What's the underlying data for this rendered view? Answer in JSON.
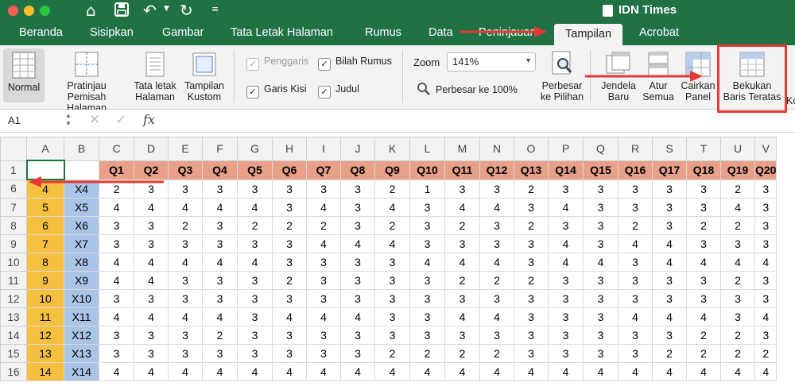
{
  "window": {
    "title": "IDN Times"
  },
  "tabs": [
    {
      "label": "Beranda",
      "active": false
    },
    {
      "label": "Sisipkan",
      "active": false
    },
    {
      "label": "Gambar",
      "active": false
    },
    {
      "label": "Tata Letak Halaman",
      "active": false
    },
    {
      "label": "Rumus",
      "active": false
    },
    {
      "label": "Data",
      "active": false
    },
    {
      "label": "Peninjauan",
      "active": false
    },
    {
      "label": "Tampilan",
      "active": true
    },
    {
      "label": "Acrobat",
      "active": false
    }
  ],
  "ribbon": {
    "normal": "Normal",
    "page_break_1": "Pratinjau",
    "page_break_2": "Pemisah Halaman",
    "page_layout_1": "Tata letak",
    "page_layout_2": "Halaman",
    "custom_view_1": "Tampilan",
    "custom_view_2": "Kustom",
    "ruler": "Penggaris",
    "formula_bar": "Bilah Rumus",
    "gridlines": "Garis Kisi",
    "headings": "Judul",
    "zoom_label": "Zoom",
    "zoom_value": "141%",
    "zoom_100": "Perbesar ke 100%",
    "zoom_sel_1": "Perbesar",
    "zoom_sel_2": "ke Pilihan",
    "new_window_1": "Jendela",
    "new_window_2": "Baru",
    "arrange_1": "Atur",
    "arrange_2": "Semua",
    "freeze_1": "Cairkan",
    "freeze_2": "Panel",
    "freeze_top_1": "Bekukan",
    "freeze_top_2": "Baris Teratas",
    "cut_label": "Ko"
  },
  "formula_bar": {
    "cell_ref": "A1",
    "fx": "fx",
    "value": ""
  },
  "colors": {
    "brand_green": "#207245",
    "header_row": "#e8a088",
    "col_a": "#f5c040",
    "col_b": "#a9c4e6",
    "annotation_red": "#e53935"
  },
  "sheet": {
    "columns": [
      "A",
      "B",
      "C",
      "D",
      "E",
      "F",
      "G",
      "H",
      "I",
      "J",
      "K",
      "L",
      "M",
      "N",
      "O",
      "P",
      "Q",
      "R",
      "S",
      "T",
      "U",
      "V"
    ],
    "header_row": {
      "num": "1",
      "cells": [
        "",
        "",
        "Q1",
        "Q2",
        "Q3",
        "Q4",
        "Q5",
        "Q6",
        "Q7",
        "Q8",
        "Q9",
        "Q10",
        "Q11",
        "Q12",
        "Q13",
        "Q14",
        "Q15",
        "Q16",
        "Q17",
        "Q18",
        "Q19",
        "Q20"
      ]
    },
    "rows": [
      {
        "num": "6",
        "a": "4",
        "b": "X4",
        "vals": [
          "2",
          "3",
          "3",
          "3",
          "3",
          "3",
          "3",
          "3",
          "2",
          "1",
          "3",
          "3",
          "2",
          "3",
          "3",
          "3",
          "3",
          "3",
          "2",
          "3"
        ]
      },
      {
        "num": "7",
        "a": "5",
        "b": "X5",
        "vals": [
          "4",
          "4",
          "4",
          "4",
          "4",
          "3",
          "4",
          "3",
          "4",
          "3",
          "4",
          "4",
          "3",
          "4",
          "3",
          "3",
          "3",
          "3",
          "4",
          "3"
        ]
      },
      {
        "num": "8",
        "a": "6",
        "b": "X6",
        "vals": [
          "3",
          "3",
          "2",
          "3",
          "2",
          "2",
          "2",
          "3",
          "2",
          "3",
          "2",
          "3",
          "2",
          "3",
          "3",
          "2",
          "3",
          "2",
          "2",
          "3"
        ]
      },
      {
        "num": "9",
        "a": "7",
        "b": "X7",
        "vals": [
          "3",
          "3",
          "3",
          "3",
          "3",
          "3",
          "4",
          "4",
          "4",
          "3",
          "3",
          "3",
          "3",
          "4",
          "3",
          "4",
          "4",
          "3",
          "3",
          "3"
        ]
      },
      {
        "num": "10",
        "a": "8",
        "b": "X8",
        "vals": [
          "4",
          "4",
          "4",
          "4",
          "4",
          "3",
          "3",
          "3",
          "3",
          "4",
          "4",
          "4",
          "3",
          "4",
          "4",
          "3",
          "4",
          "4",
          "4",
          "4"
        ]
      },
      {
        "num": "11",
        "a": "9",
        "b": "X9",
        "vals": [
          "4",
          "4",
          "3",
          "3",
          "3",
          "2",
          "3",
          "3",
          "3",
          "3",
          "2",
          "2",
          "2",
          "3",
          "3",
          "3",
          "3",
          "3",
          "2",
          "3"
        ]
      },
      {
        "num": "12",
        "a": "10",
        "b": "X10",
        "vals": [
          "3",
          "3",
          "3",
          "3",
          "3",
          "3",
          "3",
          "3",
          "3",
          "3",
          "3",
          "3",
          "3",
          "3",
          "3",
          "3",
          "3",
          "3",
          "3",
          "3"
        ]
      },
      {
        "num": "13",
        "a": "11",
        "b": "X11",
        "vals": [
          "4",
          "4",
          "4",
          "4",
          "3",
          "4",
          "4",
          "4",
          "3",
          "3",
          "4",
          "4",
          "3",
          "3",
          "3",
          "4",
          "4",
          "4",
          "3",
          "4"
        ]
      },
      {
        "num": "14",
        "a": "12",
        "b": "X12",
        "vals": [
          "3",
          "3",
          "3",
          "2",
          "3",
          "3",
          "3",
          "3",
          "3",
          "3",
          "3",
          "3",
          "3",
          "3",
          "3",
          "3",
          "3",
          "2",
          "2",
          "3"
        ]
      },
      {
        "num": "15",
        "a": "13",
        "b": "X13",
        "vals": [
          "3",
          "3",
          "3",
          "3",
          "3",
          "3",
          "3",
          "3",
          "2",
          "2",
          "2",
          "2",
          "3",
          "3",
          "3",
          "3",
          "2",
          "2",
          "2",
          "2"
        ]
      },
      {
        "num": "16",
        "a": "14",
        "b": "X14",
        "vals": [
          "4",
          "4",
          "4",
          "4",
          "4",
          "4",
          "4",
          "4",
          "4",
          "4",
          "4",
          "4",
          "4",
          "4",
          "4",
          "4",
          "4",
          "4",
          "4",
          "4"
        ]
      }
    ]
  }
}
